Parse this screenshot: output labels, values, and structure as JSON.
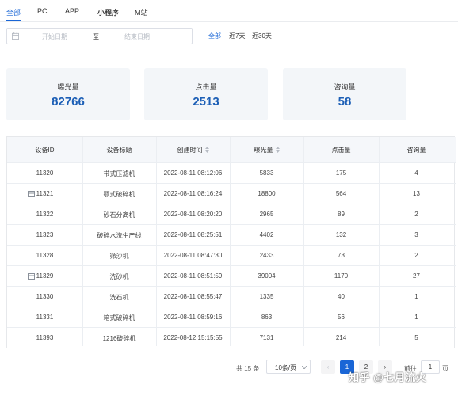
{
  "tabs": [
    {
      "label": "全部",
      "active": true
    },
    {
      "label": "PC",
      "active": false
    },
    {
      "label": "APP",
      "active": false
    },
    {
      "label": "小程序",
      "active": false
    },
    {
      "label": "M站",
      "active": false
    }
  ],
  "date_filter": {
    "start_placeholder": "开始日期",
    "separator": "至",
    "end_placeholder": "结束日期",
    "icon": "calendar-icon"
  },
  "quick_ranges": [
    {
      "label": "全部",
      "active": true
    },
    {
      "label": "近7天",
      "active": false
    },
    {
      "label": "近30天",
      "active": false
    }
  ],
  "stats": [
    {
      "label": "曝光量",
      "value": "82766"
    },
    {
      "label": "点击量",
      "value": "2513"
    },
    {
      "label": "咨询量",
      "value": "58"
    }
  ],
  "table": {
    "columns": [
      "设备ID",
      "设备标题",
      "创建时间",
      "曝光量",
      "点击量",
      "咨询量"
    ],
    "sortable_columns": [
      "创建时间",
      "曝光量"
    ],
    "rows": [
      {
        "id": "11320",
        "title": "带式压滤机",
        "created": "2022-08-11 08:12:06",
        "exposure": "5833",
        "clicks": "175",
        "inquiries": "4",
        "tag": false
      },
      {
        "id": "11321",
        "title": "颚式破碎机",
        "created": "2022-08-11 08:16:24",
        "exposure": "18800",
        "clicks": "564",
        "inquiries": "13",
        "tag": true
      },
      {
        "id": "11322",
        "title": "砂石分离机",
        "created": "2022-08-11 08:20:20",
        "exposure": "2965",
        "clicks": "89",
        "inquiries": "2",
        "tag": false
      },
      {
        "id": "11323",
        "title": "破碎水洗生产线",
        "created": "2022-08-11 08:25:51",
        "exposure": "4402",
        "clicks": "132",
        "inquiries": "3",
        "tag": false
      },
      {
        "id": "11328",
        "title": "筛沙机",
        "created": "2022-08-11 08:47:30",
        "exposure": "2433",
        "clicks": "73",
        "inquiries": "2",
        "tag": false
      },
      {
        "id": "11329",
        "title": "洗砂机",
        "created": "2022-08-11 08:51:59",
        "exposure": "39004",
        "clicks": "1170",
        "inquiries": "27",
        "tag": true
      },
      {
        "id": "11330",
        "title": "洗石机",
        "created": "2022-08-11 08:55:47",
        "exposure": "1335",
        "clicks": "40",
        "inquiries": "1",
        "tag": false
      },
      {
        "id": "11331",
        "title": "箱式破碎机",
        "created": "2022-08-11 08:59:16",
        "exposure": "863",
        "clicks": "56",
        "inquiries": "1",
        "tag": false
      },
      {
        "id": "11393",
        "title": "1216破碎机",
        "created": "2022-08-12 15:15:55",
        "exposure": "7131",
        "clicks": "214",
        "inquiries": "5",
        "tag": false
      }
    ]
  },
  "pagination": {
    "total": "共 15 条",
    "page_size": "10条/页",
    "prev": "‹",
    "pages": [
      "1",
      "2"
    ],
    "current": "1",
    "next": "›",
    "goto_label": "前往",
    "goto_value": "1",
    "page_suffix": "页"
  },
  "watermark": "知乎 @七月流火",
  "colors": {
    "accent": "#1a66d6",
    "stat_value": "#1c5fb6",
    "card_bg": "#f3f6f9",
    "header_bg": "#f5f7fa"
  }
}
